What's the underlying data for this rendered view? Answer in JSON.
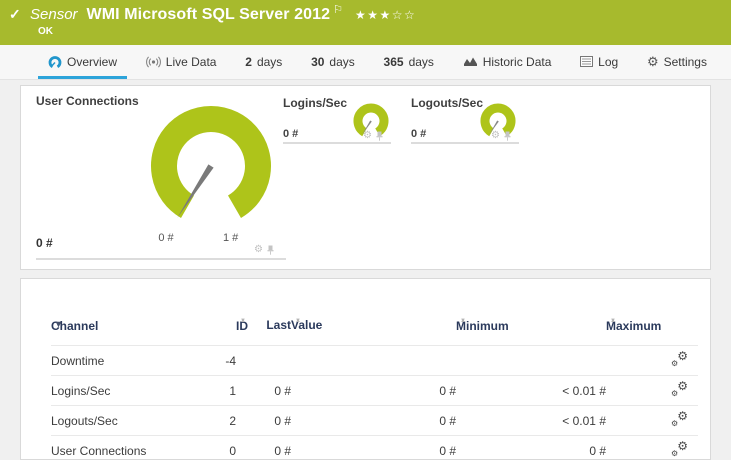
{
  "header": {
    "kind": "Sensor",
    "title": "WMI Microsoft SQL Server 2012",
    "status": "OK",
    "rating_filled": 3,
    "rating_total": 5
  },
  "tabs": [
    {
      "label": "Overview",
      "active": true
    },
    {
      "label": "Live Data"
    },
    {
      "num": "2",
      "label": "days"
    },
    {
      "num": "30",
      "label": "days"
    },
    {
      "num": "365",
      "label": "days"
    },
    {
      "label": "Historic Data"
    },
    {
      "label": "Log"
    },
    {
      "label": "Settings"
    }
  ],
  "gauges": {
    "main": {
      "title": "User Connections",
      "value": "0 #",
      "scale_min": "0 #",
      "scale_max": "1 #"
    },
    "logins": {
      "title": "Logins/Sec",
      "value": "0 #"
    },
    "logouts": {
      "title": "Logouts/Sec",
      "value": "0 #"
    }
  },
  "table": {
    "headers": {
      "channel": "Channel",
      "id": "ID",
      "last_line1": "Last",
      "last_line2": "Value",
      "minimum": "Minimum",
      "maximum": "Maximum"
    },
    "rows": [
      {
        "channel": "Downtime",
        "id": "-4",
        "last": "",
        "min": "",
        "max": ""
      },
      {
        "channel": "Logins/Sec",
        "id": "1",
        "last": "0 #",
        "min": "0 #",
        "max": "< 0.01 #"
      },
      {
        "channel": "Logouts/Sec",
        "id": "2",
        "last": "0 #",
        "min": "0 #",
        "max": "< 0.01 #"
      },
      {
        "channel": "User Connections",
        "id": "0",
        "last": "0 #",
        "min": "0 #",
        "max": "0 #"
      }
    ]
  },
  "icons": {
    "check": "✓",
    "flag": "⚐",
    "star_filled": "★",
    "star_empty": "☆",
    "gear": "⚙",
    "sort_desc": "▾",
    "sort_up": "▲",
    "sort_down": "▼"
  },
  "colors": {
    "header_green": "#a7ba2d",
    "gauge_green": "#aec41a",
    "accent_blue": "#2da4da",
    "table_header_navy": "#2b3a5c"
  }
}
